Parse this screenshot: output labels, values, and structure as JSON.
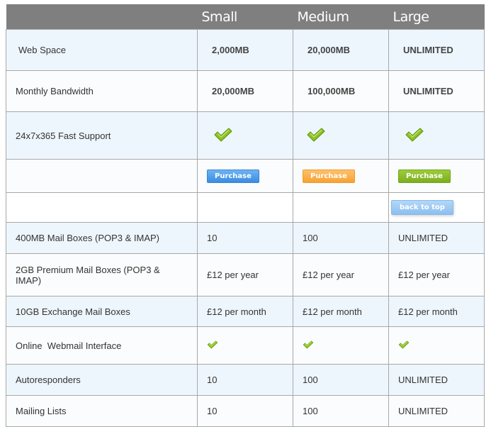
{
  "header": {
    "plans": [
      "Small",
      "Medium",
      "Large"
    ]
  },
  "colors": {
    "header_bg": "#7f7f7f",
    "row_alt_bg": "#eef6fd",
    "check_green": "#8cc423",
    "purchase_small": "#4a98e8",
    "purchase_medium": "#f9ad48",
    "purchase_large": "#86b726",
    "back_to_top": "#9fcaf3"
  },
  "rows": {
    "web_space": {
      "label": "Web Space",
      "values": [
        "2,000MB",
        "20,000MB",
        "UNLIMITED"
      ]
    },
    "bandwidth": {
      "label": "Monthly Bandwidth",
      "values": [
        "20,000MB",
        "100,000MB",
        "UNLIMITED"
      ]
    },
    "support": {
      "label": "24x7x365 Fast Support",
      "values": [
        "check-icon",
        "check-icon",
        "check-icon"
      ]
    },
    "purchase": {
      "label": "",
      "buttons": [
        "Purchase",
        "Purchase",
        "Purchase"
      ]
    },
    "back_to_top": {
      "label": "back to top"
    },
    "mailboxes_400": {
      "label": "400MB Mail Boxes (POP3 & IMAP)",
      "values": [
        "10",
        "100",
        "UNLIMITED"
      ]
    },
    "mailboxes_2gb": {
      "label": "2GB Premium Mail Boxes (POP3 & IMAP)",
      "values": [
        "£12 per year",
        "£12 per year",
        "£12 per year"
      ]
    },
    "exchange": {
      "label": "10GB Exchange Mail Boxes",
      "values": [
        "£12 per month",
        "£12 per month",
        "£12 per month"
      ]
    },
    "webmail": {
      "label": "Online  Webmail Interface",
      "values": [
        "check-icon",
        "check-icon",
        "check-icon"
      ]
    },
    "autoresponders": {
      "label": "Autoresponders",
      "values": [
        "10",
        "100",
        "UNLIMITED"
      ]
    },
    "mailing_lists": {
      "label": "Mailing Lists",
      "values": [
        "10",
        "100",
        "UNLIMITED"
      ]
    }
  }
}
